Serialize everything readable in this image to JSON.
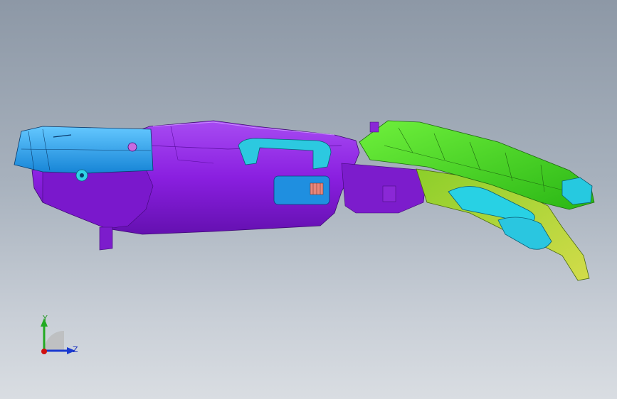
{
  "viewport": {
    "background_top": "#8d98a6",
    "background_bottom": "#d9dde2"
  },
  "model": {
    "part_colors": {
      "main_body": "#8a1fe0",
      "main_body_shade": "#6a12b4",
      "duct_blue": "#1aa0e8",
      "duct_cyan": "#27d4e6",
      "cover_green": "#3dd21d",
      "cover_green_light": "#7ef04a",
      "flange_olive": "#b6d23a"
    }
  },
  "triad": {
    "y_label": "Y",
    "z_label": "Z",
    "y_color": "#22aa22",
    "z_color": "#1a3ad0",
    "x_color": "#d01010"
  }
}
